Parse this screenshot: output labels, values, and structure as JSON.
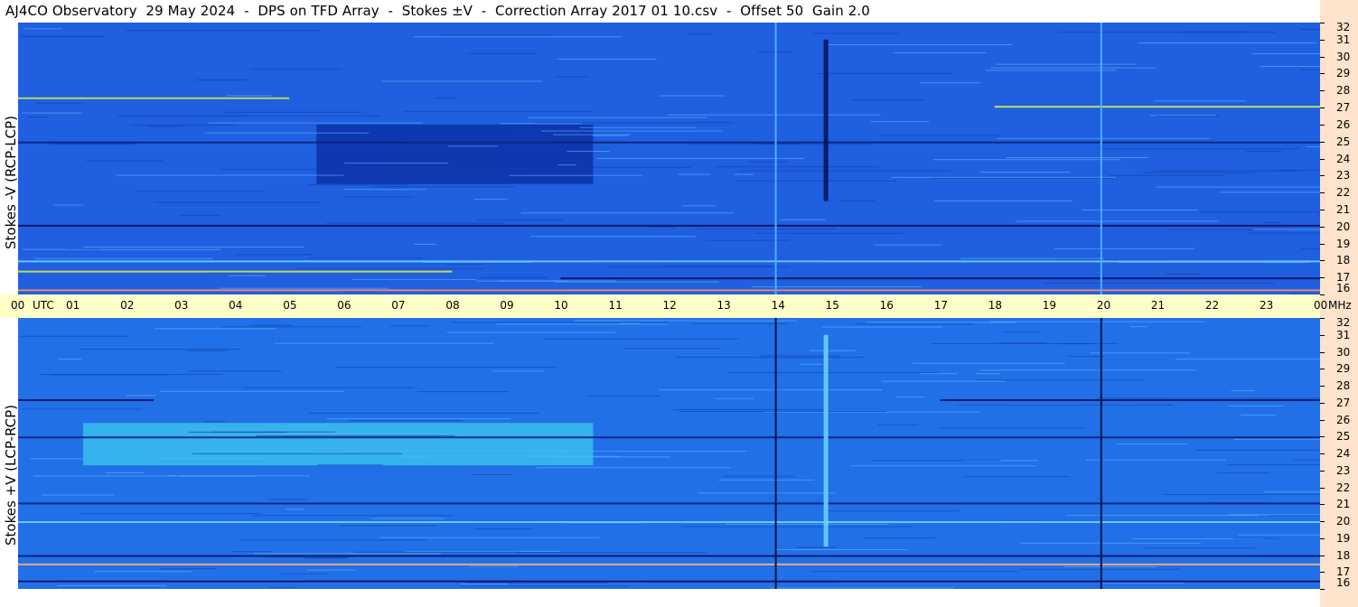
{
  "title": "AJ4CO Observatory  29 May 2024  -  DPS on TFD Array  -  Stokes ±V  -  Correction Array 2017 01 10.csv  -  Offset 50  Gain 2.0",
  "chart_data": {
    "type": "heatmap",
    "x_axis": {
      "unit_label": "UTC",
      "ticks": [
        "00",
        "01",
        "02",
        "03",
        "04",
        "05",
        "06",
        "07",
        "08",
        "09",
        "10",
        "11",
        "12",
        "13",
        "14",
        "15",
        "16",
        "17",
        "18",
        "19",
        "20",
        "21",
        "22",
        "23",
        "00"
      ],
      "range_hours": [
        0,
        24
      ]
    },
    "y_axis": {
      "unit_label": "MHz",
      "range": [
        16,
        32
      ],
      "ticks": [
        32,
        31,
        30,
        29,
        28,
        27,
        26,
        25,
        24,
        23,
        22,
        21,
        20,
        19,
        18,
        17,
        16
      ]
    },
    "panels": [
      {
        "ylabel": "Stokes -V (RCP-LCP)",
        "base_color": "#1f5fe0",
        "dark_region": {
          "x_hours": [
            5.5,
            10.6
          ],
          "y_mhz": [
            22.5,
            26.0
          ],
          "color": "#0b2aa0"
        },
        "features": [
          {
            "kind": "vertical_line",
            "x_hour": 13.95,
            "color": "#4ab0ff"
          },
          {
            "kind": "vertical_line",
            "x_hour": 19.95,
            "color": "#4ab0ff"
          },
          {
            "kind": "vertical_burst",
            "x_hour": 14.85,
            "y_mhz": [
              21.5,
              31.0
            ],
            "color": "#06155a"
          }
        ],
        "bands": [
          {
            "y_mhz": 27.6,
            "x_hours": [
              0,
              5
            ],
            "color": "#c8e84a"
          },
          {
            "y_mhz": 27.1,
            "x_hours": [
              18,
              24
            ],
            "color": "#d6e850"
          },
          {
            "y_mhz": 25.0,
            "x_hours": [
              0,
              24
            ],
            "color": "#0a1f80"
          },
          {
            "y_mhz": 20.1,
            "x_hours": [
              0,
              24
            ],
            "color": "#061260"
          },
          {
            "y_mhz": 18.0,
            "x_hours": [
              0,
              24
            ],
            "color": "#6ed0ff"
          },
          {
            "y_mhz": 17.4,
            "x_hours": [
              0,
              8
            ],
            "color": "#d0e848"
          },
          {
            "y_mhz": 17.0,
            "x_hours": [
              10,
              24
            ],
            "color": "#061260"
          },
          {
            "y_mhz": 16.3,
            "x_hours": [
              0,
              24
            ],
            "color": "#ff8a60"
          }
        ]
      },
      {
        "ylabel": "Stokes +V (LCP-RCP)",
        "base_color": "#2270e8",
        "bright_region": {
          "x_hours": [
            1.2,
            10.6
          ],
          "y_mhz": [
            23.3,
            25.8
          ],
          "color": "#3ec8ee"
        },
        "features": [
          {
            "kind": "vertical_line",
            "x_hour": 13.95,
            "color": "#051040"
          },
          {
            "kind": "vertical_line",
            "x_hour": 19.95,
            "color": "#051040"
          },
          {
            "kind": "vertical_burst",
            "x_hour": 14.85,
            "y_mhz": [
              18.5,
              31.0
            ],
            "color": "#6ad0ff"
          }
        ],
        "bands": [
          {
            "y_mhz": 27.2,
            "x_hours": [
              0,
              2.5
            ],
            "color": "#061260"
          },
          {
            "y_mhz": 27.2,
            "x_hours": [
              17,
              24
            ],
            "color": "#061260"
          },
          {
            "y_mhz": 25.0,
            "x_hours": [
              0,
              24
            ],
            "color": "#0a1f80"
          },
          {
            "y_mhz": 21.1,
            "x_hours": [
              0,
              24
            ],
            "color": "#0a1f80"
          },
          {
            "y_mhz": 20.0,
            "x_hours": [
              0,
              24
            ],
            "color": "#6ed0ff"
          },
          {
            "y_mhz": 18.0,
            "x_hours": [
              0,
              24
            ],
            "color": "#061260"
          },
          {
            "y_mhz": 17.5,
            "x_hours": [
              0,
              24
            ],
            "color": "#ffb070"
          },
          {
            "y_mhz": 16.5,
            "x_hours": [
              0,
              24
            ],
            "color": "#061260"
          }
        ]
      }
    ]
  }
}
